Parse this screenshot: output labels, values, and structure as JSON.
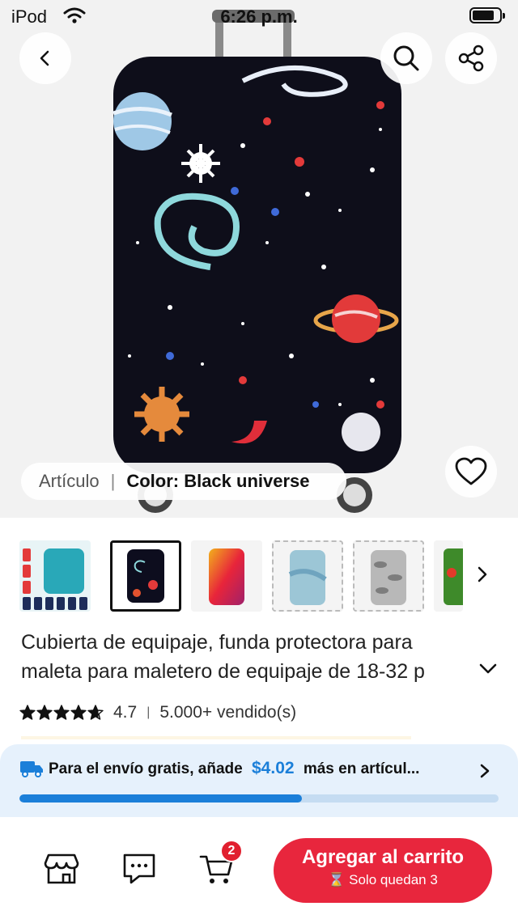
{
  "status_bar": {
    "carrier": "iPod",
    "time": "6:26 p.m."
  },
  "hero": {
    "spec_label": "Artículo",
    "spec_value": "Color: Black universe"
  },
  "thumbnails": [
    {
      "name": "thumb-collage",
      "colors": [
        "#29a8b8",
        "#1d2d5a"
      ]
    },
    {
      "name": "thumb-black-universe",
      "colors": [
        "#0d0d1e",
        "#e3532f"
      ]
    },
    {
      "name": "thumb-rainbow",
      "colors": [
        "#f2b11c",
        "#e8253a"
      ]
    },
    {
      "name": "thumb-blue-marble",
      "colors": [
        "#9cc6d6",
        "#6fa4bf"
      ]
    },
    {
      "name": "thumb-grey-camo",
      "colors": [
        "#b8b8b8",
        "#7d7d7d"
      ]
    },
    {
      "name": "thumb-graffiti",
      "colors": [
        "#3e8a2a",
        "#e33a2a"
      ]
    }
  ],
  "product": {
    "title": "Cubierta de equipaje, funda protectora para maleta para maletero de equipaje de 18-32 p",
    "rating": "4.7",
    "sold": "5.000+ vendido(s)",
    "stars": 4.7
  },
  "shipping": {
    "prefix": "Para el envío gratis, añade",
    "amount": "$4.02",
    "suffix": "más en artícul...",
    "progress_percent": 59
  },
  "bottom_bar": {
    "cart_count": "2",
    "add_label": "Agregar al carrito",
    "stock_label": "Solo quedan 3"
  },
  "colors": {
    "accent_red": "#e8263d",
    "accent_blue": "#1b7fd9"
  }
}
